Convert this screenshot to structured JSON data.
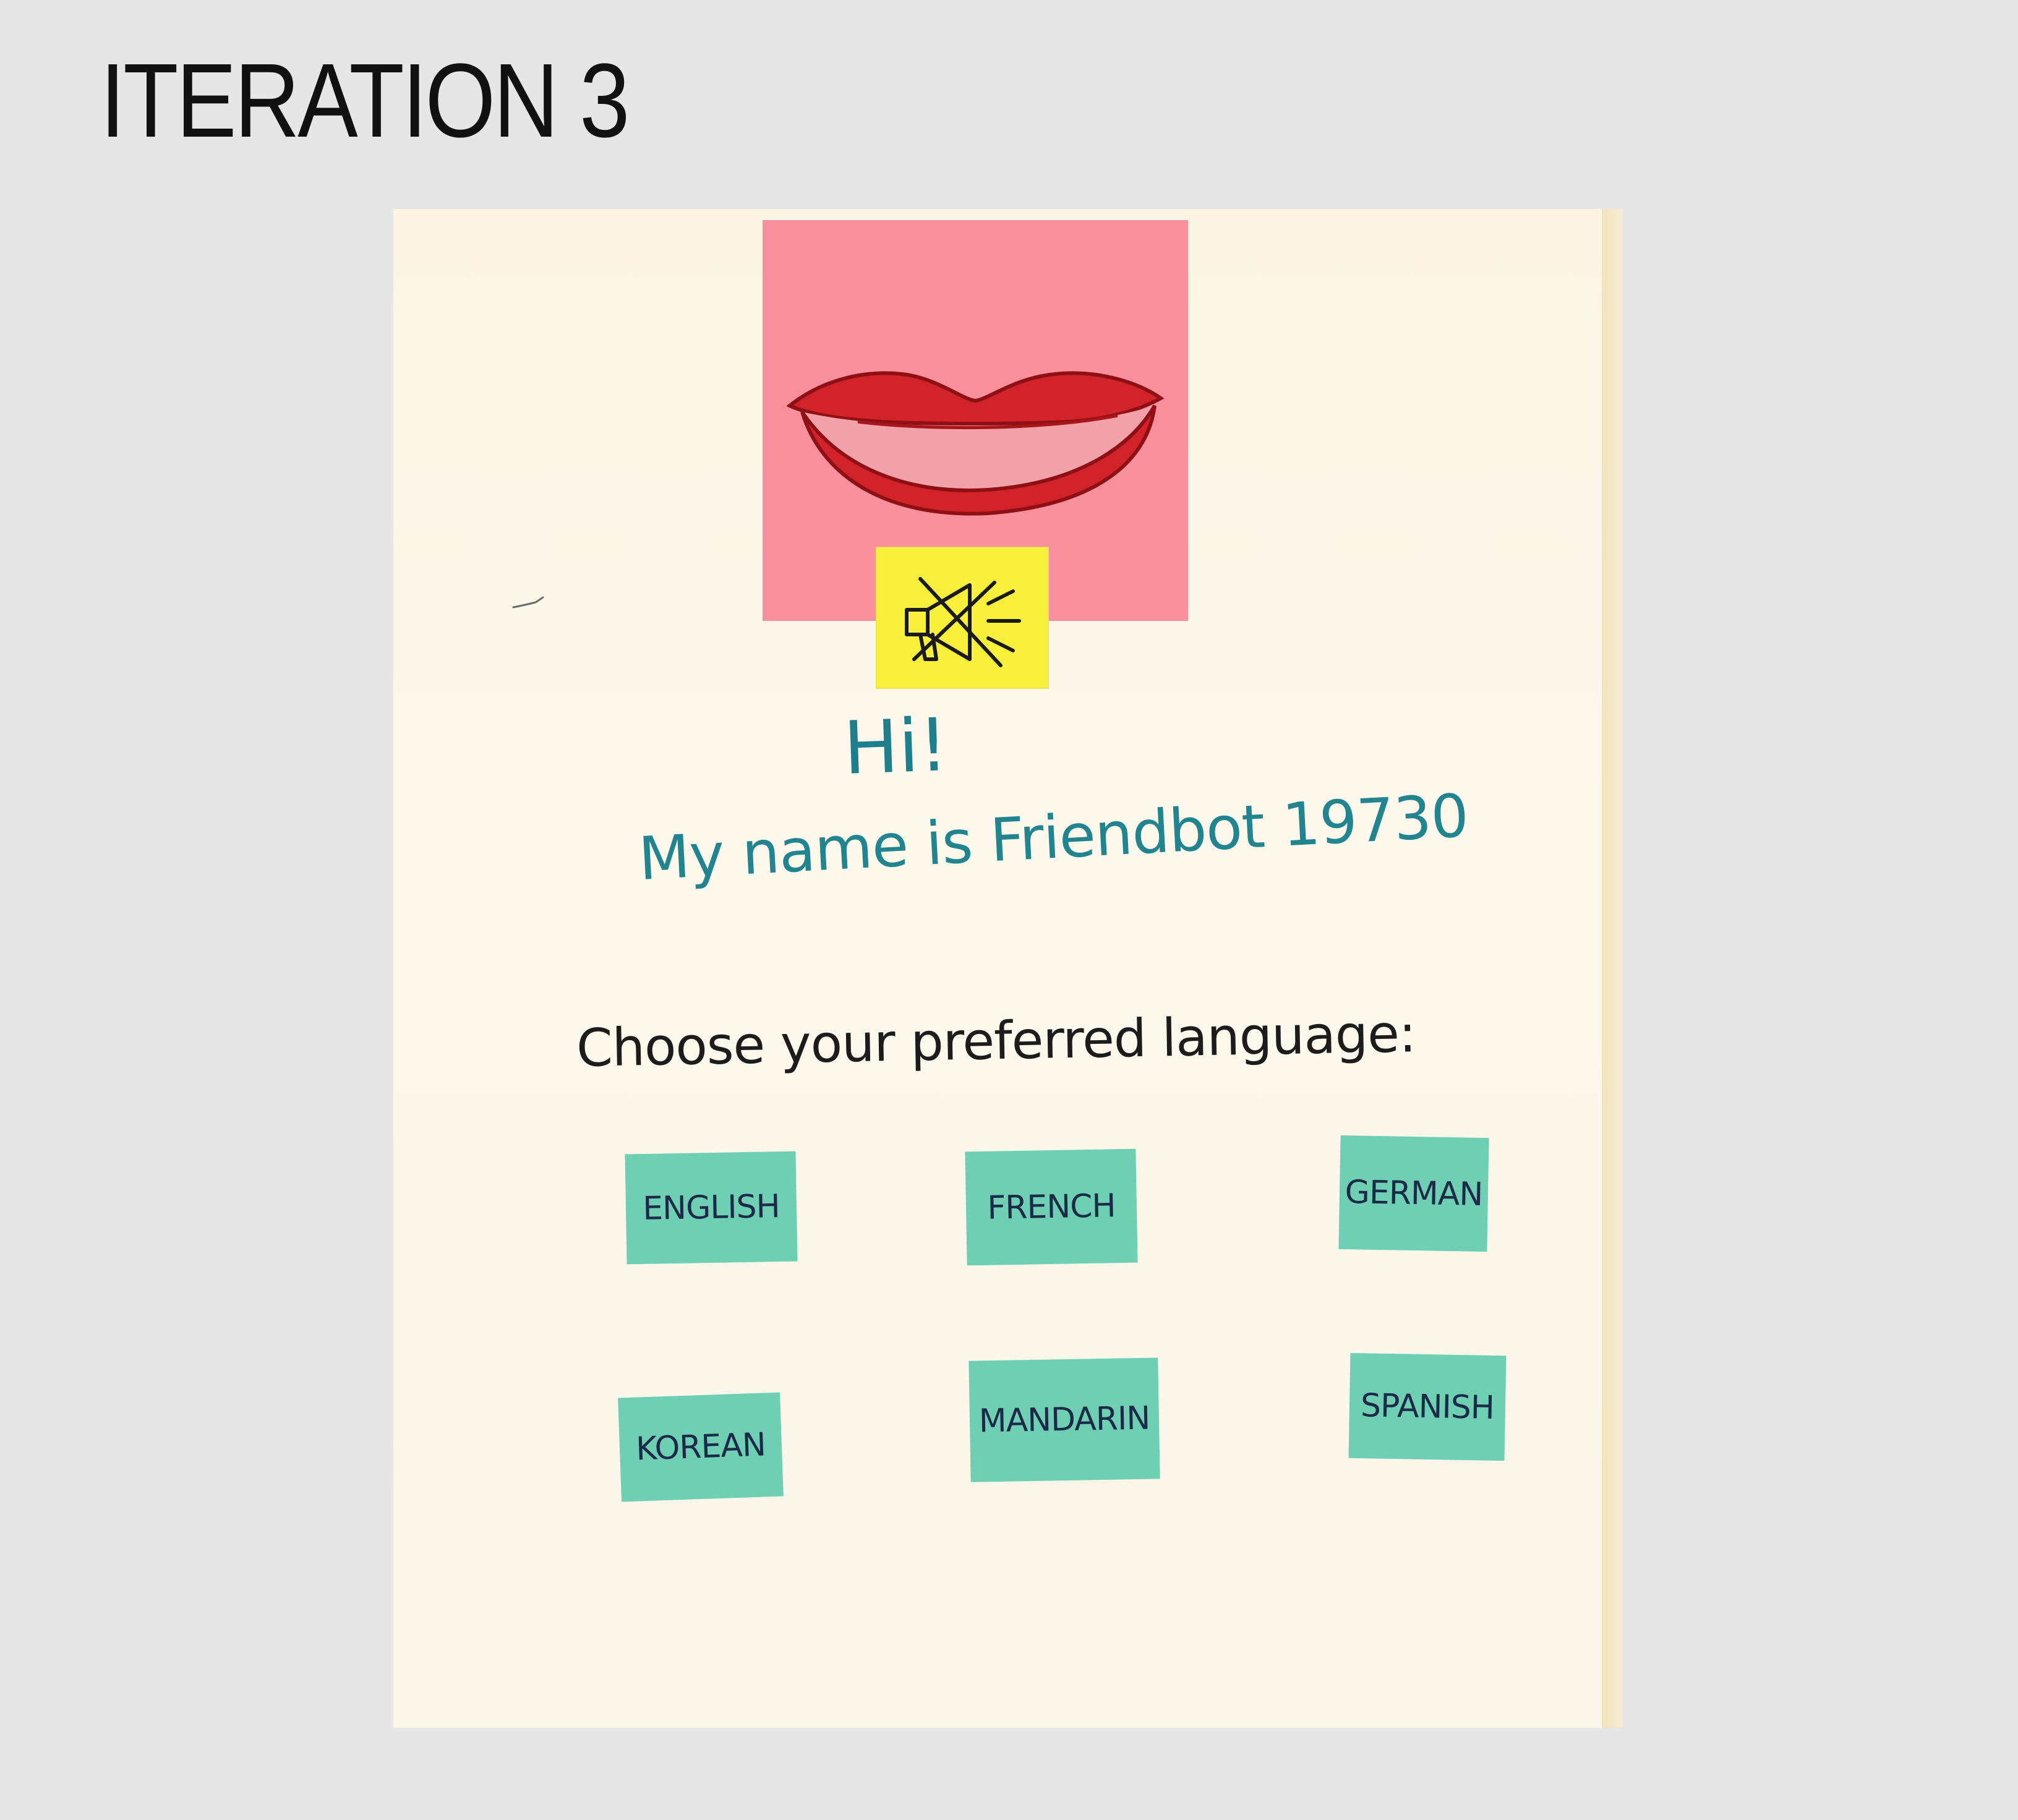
{
  "page": {
    "title": "ITERATION 3"
  },
  "prototype": {
    "greeting": "Hi!",
    "bot_intro": "My name is Friendbot 19730",
    "language_prompt": "Choose your preferred language:",
    "avatar_icon": "mouth-icon",
    "speaker_icon": "speaker-muted-icon",
    "languages": [
      {
        "id": "english",
        "label": "ENGLISH"
      },
      {
        "id": "french",
        "label": "FRENCH"
      },
      {
        "id": "german",
        "label": "GERMAN"
      },
      {
        "id": "korean",
        "label": "KOREAN"
      },
      {
        "id": "mandarin",
        "label": "MANDARIN"
      },
      {
        "id": "spanish",
        "label": "SPANISH"
      }
    ]
  },
  "colors": {
    "background": "#e6e6e6",
    "paper": "#fcf5e4",
    "mouth_note": "#f78f9c",
    "speaker_note": "#f9f03c",
    "language_note": "#6fcfb2",
    "greeting_ink": "#1f7e8c",
    "prompt_ink": "#1c1c1c"
  }
}
